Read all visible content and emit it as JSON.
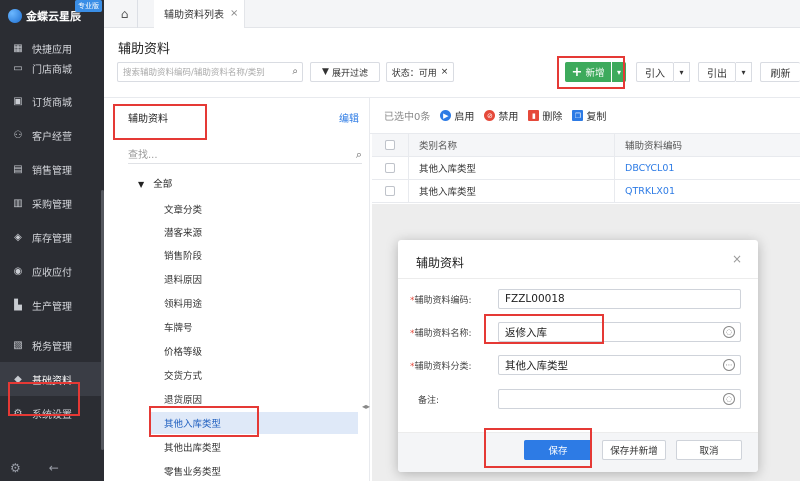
{
  "sidebar": {
    "logo_text": "金蝶云星辰",
    "logo_badge": "专业版",
    "items": [
      {
        "label": "快捷应用",
        "icon": "grid-icon"
      },
      {
        "label": "门店商城",
        "icon": "store-icon"
      },
      {
        "label": "订货商城",
        "icon": "bag-icon"
      },
      {
        "label": "客户经营",
        "icon": "handshake-icon"
      },
      {
        "label": "销售管理",
        "icon": "chart-icon"
      },
      {
        "label": "采购管理",
        "icon": "cart-icon"
      },
      {
        "label": "库存管理",
        "icon": "box-icon"
      },
      {
        "label": "应收应付",
        "icon": "coin-icon"
      },
      {
        "label": "生产管理",
        "icon": "factory-icon"
      },
      {
        "label": "税务管理",
        "icon": "tax-icon"
      },
      {
        "label": "基础资料",
        "icon": "layers-icon"
      },
      {
        "label": "系统设置",
        "icon": "gear-icon"
      }
    ],
    "active_item": "基础资料"
  },
  "tabs": {
    "active": "辅助资料列表"
  },
  "page": {
    "title": "辅助资料",
    "search_placeholder": "搜索辅助资料编码/辅助资料名称/类别",
    "filter_label": "展开过滤",
    "status_tag": "状态：可用",
    "add_label": "新增",
    "import_label": "引入",
    "export_label": "引出",
    "refresh_label": "刷新"
  },
  "tree": {
    "header": "辅助资料",
    "edit_label": "编辑",
    "search_placeholder": "查找...",
    "root": "全部",
    "items": [
      "文章分类",
      "潜客来源",
      "销售阶段",
      "退料原因",
      "领料用途",
      "车牌号",
      "价格等级",
      "交货方式",
      "退货原因",
      "其他入库类型",
      "其他出库类型",
      "零售业务类型"
    ],
    "selected": "其他入库类型"
  },
  "grid": {
    "selected_count": "已选中0条",
    "enable_label": "启用",
    "disable_label": "禁用",
    "delete_label": "删除",
    "copy_label": "复制",
    "columns": [
      "类别名称",
      "辅助资料编码"
    ],
    "rows": [
      {
        "category": "其他入库类型",
        "code": "DBCYCL01"
      },
      {
        "category": "其他入库类型",
        "code": "QTRKLX01"
      }
    ]
  },
  "modal": {
    "title": "辅助资料",
    "fields": {
      "code_label": "辅助资料编码:",
      "code_value": "FZZL00018",
      "name_label": "辅助资料名称:",
      "name_value": "返修入库",
      "category_label": "辅助资料分类:",
      "category_value": "其他入库类型",
      "remark_label": "备注:",
      "remark_value": ""
    },
    "save_label": "保存",
    "save_new_label": "保存并新增",
    "cancel_label": "取消"
  },
  "colors": {
    "sidebar_bg": "#2b2d33",
    "primary": "#2d7be5",
    "add_green": "#3daa5c",
    "highlight_red": "#e53935"
  }
}
